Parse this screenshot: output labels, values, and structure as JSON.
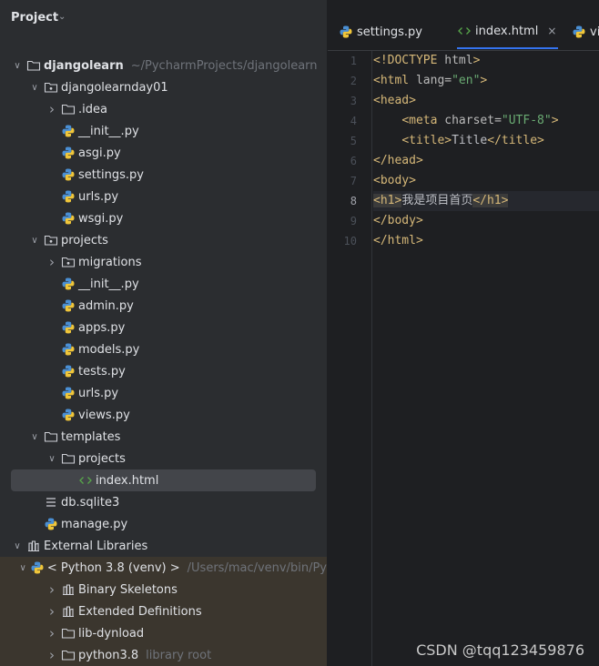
{
  "project_panel": {
    "title": "Project",
    "tree": [
      {
        "depth": 0,
        "expanded": true,
        "icon": "folder-icon",
        "label": "djangolearn",
        "bold": true,
        "hint": "~/PycharmProjects/djangolearn"
      },
      {
        "depth": 1,
        "expanded": true,
        "icon": "package-folder-icon",
        "label": "djangolearnday01"
      },
      {
        "depth": 2,
        "expanded": false,
        "icon": "folder-icon",
        "label": ".idea"
      },
      {
        "depth": 2,
        "icon": "python-file-icon",
        "label": "__init__.py"
      },
      {
        "depth": 2,
        "icon": "python-file-icon",
        "label": "asgi.py"
      },
      {
        "depth": 2,
        "icon": "python-file-icon",
        "label": "settings.py"
      },
      {
        "depth": 2,
        "icon": "python-file-icon",
        "label": "urls.py"
      },
      {
        "depth": 2,
        "icon": "python-file-icon",
        "label": "wsgi.py"
      },
      {
        "depth": 1,
        "expanded": true,
        "icon": "package-folder-icon",
        "label": "projects"
      },
      {
        "depth": 2,
        "expanded": false,
        "icon": "package-folder-icon",
        "label": "migrations"
      },
      {
        "depth": 2,
        "icon": "python-file-icon",
        "label": "__init__.py"
      },
      {
        "depth": 2,
        "icon": "python-file-icon",
        "label": "admin.py"
      },
      {
        "depth": 2,
        "icon": "python-file-icon",
        "label": "apps.py"
      },
      {
        "depth": 2,
        "icon": "python-file-icon",
        "label": "models.py"
      },
      {
        "depth": 2,
        "icon": "python-file-icon",
        "label": "tests.py"
      },
      {
        "depth": 2,
        "icon": "python-file-icon",
        "label": "urls.py"
      },
      {
        "depth": 2,
        "icon": "python-file-icon",
        "label": "views.py"
      },
      {
        "depth": 1,
        "expanded": true,
        "icon": "folder-icon",
        "label": "templates"
      },
      {
        "depth": 2,
        "expanded": true,
        "icon": "folder-icon",
        "label": "projects"
      },
      {
        "depth": 3,
        "icon": "html-file-icon",
        "label": "index.html",
        "selected": true
      },
      {
        "depth": 1,
        "icon": "database-file-icon",
        "label": "db.sqlite3"
      },
      {
        "depth": 1,
        "icon": "python-file-icon",
        "label": "manage.py"
      },
      {
        "depth": 0,
        "expanded": true,
        "icon": "library-icon",
        "label": "External Libraries"
      },
      {
        "depth": 1,
        "expanded": true,
        "icon": "python-file-icon",
        "label": "< Python 3.8 (venv) >",
        "hint": "/Users/mac/venv/bin/Py",
        "lib": true
      },
      {
        "depth": 2,
        "expanded": false,
        "icon": "library-icon",
        "label": "Binary Skeletons",
        "lib": true
      },
      {
        "depth": 2,
        "expanded": false,
        "icon": "library-icon",
        "label": "Extended Definitions",
        "lib": true
      },
      {
        "depth": 2,
        "expanded": false,
        "icon": "folder-icon",
        "label": "lib-dynload",
        "lib": true
      },
      {
        "depth": 2,
        "expanded": false,
        "icon": "folder-icon",
        "label": "python3.8",
        "hint": "library root",
        "lib": true
      }
    ]
  },
  "editor": {
    "tabs": [
      {
        "label": "settings.py",
        "icon": "python-file-icon",
        "active": false,
        "closable": false
      },
      {
        "label": "index.html",
        "icon": "html-file-icon",
        "active": true,
        "closable": true,
        "close_glyph": "×"
      },
      {
        "label": "vi",
        "icon": "python-file-icon",
        "active": false,
        "closable": false
      }
    ],
    "current_line": 8,
    "lines": [
      {
        "n": "1",
        "parts": [
          {
            "c": "t",
            "x": "<!DOCTYPE "
          },
          {
            "c": "a",
            "x": "html"
          },
          {
            "c": "t",
            "x": ">"
          }
        ]
      },
      {
        "n": "2",
        "parts": [
          {
            "c": "t",
            "x": "<html "
          },
          {
            "c": "a",
            "x": "lang="
          },
          {
            "c": "s",
            "x": "\"en\""
          },
          {
            "c": "t",
            "x": ">"
          }
        ]
      },
      {
        "n": "3",
        "parts": [
          {
            "c": "t",
            "x": "<head>"
          }
        ]
      },
      {
        "n": "4",
        "parts": [
          {
            "c": "p",
            "x": "    "
          },
          {
            "c": "t",
            "x": "<meta "
          },
          {
            "c": "a",
            "x": "charset="
          },
          {
            "c": "s",
            "x": "\"UTF-8\""
          },
          {
            "c": "t",
            "x": ">"
          }
        ]
      },
      {
        "n": "5",
        "parts": [
          {
            "c": "p",
            "x": "    "
          },
          {
            "c": "t",
            "x": "<title>"
          },
          {
            "c": "p",
            "x": "Title"
          },
          {
            "c": "t",
            "x": "</title>"
          }
        ]
      },
      {
        "n": "6",
        "parts": [
          {
            "c": "t",
            "x": "</head>"
          }
        ]
      },
      {
        "n": "7",
        "parts": [
          {
            "c": "t",
            "x": "<body>"
          }
        ]
      },
      {
        "n": "8",
        "parts": [
          {
            "c": "t hl",
            "x": "<h1>"
          },
          {
            "c": "p",
            "x": "我是项目首页"
          },
          {
            "c": "t hl",
            "x": "</h1>"
          }
        ]
      },
      {
        "n": "9",
        "parts": [
          {
            "c": "t",
            "x": "</body>"
          }
        ]
      },
      {
        "n": "10",
        "parts": [
          {
            "c": "t",
            "x": "</html>"
          }
        ]
      }
    ]
  },
  "watermark": "CSDN @tqq123459876",
  "colors": {
    "panel_bg": "#2b2d30",
    "editor_bg": "#1e1f22",
    "tag": "#d5b778",
    "string": "#6aab73",
    "accent": "#3574f0"
  }
}
